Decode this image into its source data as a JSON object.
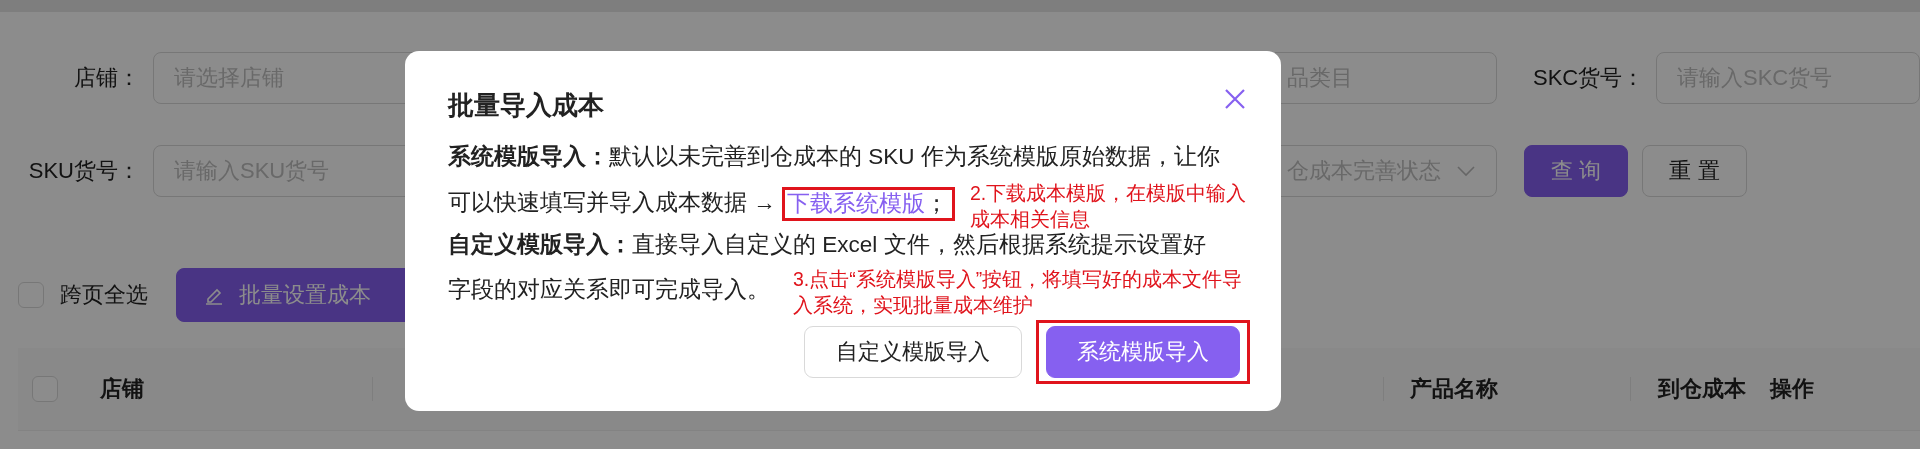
{
  "filter_rows": [
    [
      {
        "kind": "input",
        "label": "店铺：",
        "placeholder": "请选择店铺"
      },
      {
        "kind": "input",
        "placeholder": "品类目"
      },
      {
        "kind": "input",
        "label": "SKC货号：",
        "placeholder": "请输入SKC货号"
      }
    ],
    [
      {
        "kind": "input",
        "label": "SKU货号：",
        "placeholder": "请输入SKU货号"
      },
      {
        "kind": "select",
        "placeholder": "仓成本完善状态"
      }
    ]
  ],
  "filter_buttons": [
    {
      "label": "查 询",
      "primary": true
    },
    {
      "label": "重 置",
      "primary": false
    }
  ],
  "select_all": {
    "label": "跨页全选",
    "checked": false
  },
  "bulk_button": {
    "label": "批量设置成本"
  },
  "table": {
    "header_checked": false,
    "columns": [
      {
        "label": "店铺"
      },
      {
        "label": "产品名称"
      },
      {
        "label": "到仓成本"
      },
      {
        "label": "操作"
      }
    ]
  },
  "dialog": {
    "title": "批量导入成本",
    "lines": [
      {
        "text": "**系统模版导入：**默认以未完善到仓成本的 SKU 作为系统模版原始数据，让你"
      },
      {
        "text": "可以快速填写并导入成本数据 → ",
        "link": "下载系统模版",
        "suffix": "；",
        "annotated": true
      },
      {
        "text": "**自定义模版导入：**直接导入自定义的 Excel 文件，然后根据系统提示设置好"
      },
      {
        "text": "字段的对应关系即可完成导入。"
      }
    ],
    "buttons": [
      {
        "label": "自定义模版导入",
        "primary": false,
        "annotated": false
      },
      {
        "label": "系统模版导入",
        "primary": true,
        "annotated": true
      }
    ],
    "annotations": [
      "2.下载成本模版，在模版中输入成本相关信息",
      "3.点击“系统模版导入”按钮，将填写好的成本文件导入系统，实现批量成本维护"
    ]
  }
}
